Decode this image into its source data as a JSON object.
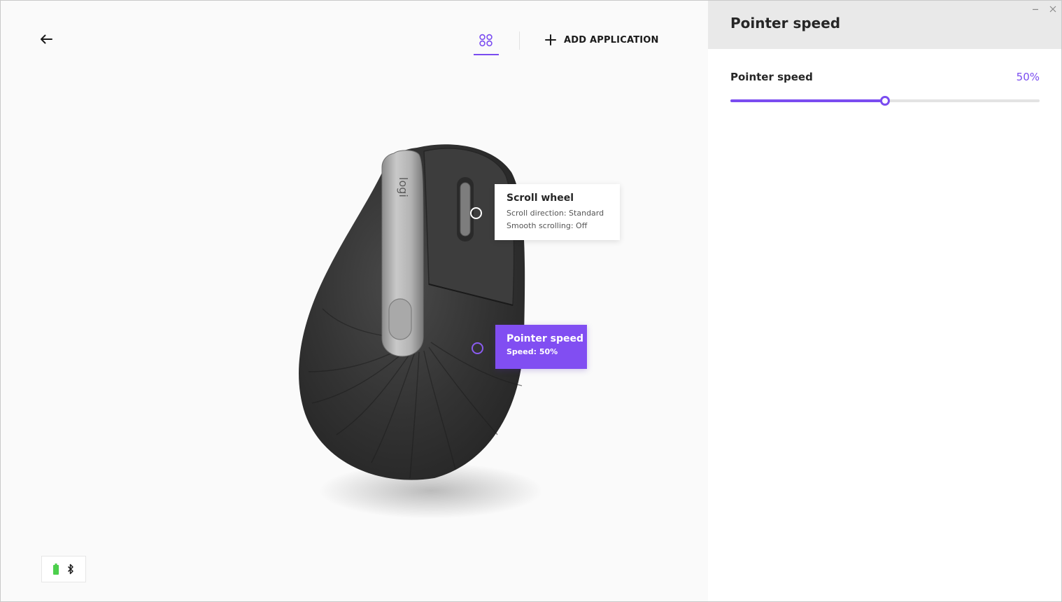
{
  "header": {
    "add_application_label": "ADD APPLICATION"
  },
  "device": {
    "brand_logo_text": "logi"
  },
  "callouts": {
    "scroll_wheel": {
      "title": "Scroll wheel",
      "direction": "Scroll direction: Standard",
      "smooth": "Smooth scrolling: Off"
    },
    "pointer_speed": {
      "title": "Pointer speed",
      "speed": "Speed: 50%"
    }
  },
  "status": {
    "icons": [
      "battery-icon",
      "bluetooth-icon"
    ],
    "battery_color": "#4ccf4c"
  },
  "panel": {
    "title": "Pointer speed",
    "setting_label": "Pointer speed",
    "value_text": "50%",
    "slider_fraction": 0.5
  },
  "colors": {
    "accent": "#7a4cf0"
  }
}
